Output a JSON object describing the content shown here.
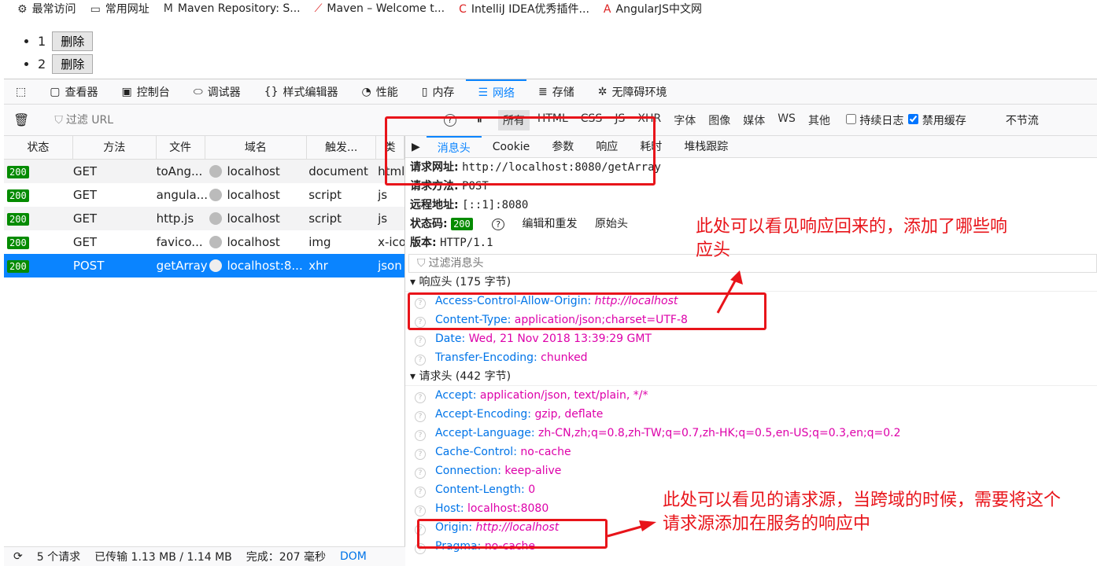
{
  "bookmarks": [
    {
      "icon": "gear-icon",
      "label": "最常访问"
    },
    {
      "icon": "folder-icon",
      "label": "常用网址"
    },
    {
      "icon": "maven-icon",
      "label": "Maven Repository: S..."
    },
    {
      "icon": "feather-icon",
      "label": "Maven – Welcome t..."
    },
    {
      "icon": "intellij-icon",
      "label": "IntelliJ IDEA优秀插件..."
    },
    {
      "icon": "angular-icon",
      "label": "AngularJS中文网"
    }
  ],
  "page": {
    "items": [
      {
        "num": "1",
        "button": "删除"
      },
      {
        "num": "2",
        "button": "删除"
      }
    ]
  },
  "toolbar": {
    "tabs": [
      {
        "icon": "inspector-icon",
        "label": "查看器"
      },
      {
        "icon": "console-icon",
        "label": "控制台"
      },
      {
        "icon": "debugger-icon",
        "label": "调试器"
      },
      {
        "icon": "style-editor-icon",
        "label": "样式编辑器"
      },
      {
        "icon": "performance-icon",
        "label": "性能"
      },
      {
        "icon": "memory-icon",
        "label": "内存"
      },
      {
        "icon": "network-icon",
        "label": "网络",
        "active": true
      },
      {
        "icon": "storage-icon",
        "label": "存储"
      },
      {
        "icon": "accessibility-icon",
        "label": "无障碍环境"
      }
    ]
  },
  "filter": {
    "placeholder": "过滤 URL",
    "types": [
      "所有",
      "HTML",
      "CSS",
      "JS",
      "XHR",
      "字体",
      "图像",
      "媒体",
      "WS",
      "其他"
    ],
    "persist_log": "持续日志",
    "persist_checked": false,
    "disable_cache": "禁用缓存",
    "cache_checked": true,
    "throttle": "不节流"
  },
  "table": {
    "headers": [
      "状态",
      "方法",
      "文件",
      "域名",
      "触发...",
      "类"
    ],
    "rows": [
      {
        "status": "200",
        "method": "GET",
        "file": "toAng...",
        "domain": "localhost",
        "cause": "document",
        "type": "html"
      },
      {
        "status": "200",
        "method": "GET",
        "file": "angula...",
        "domain": "localhost",
        "cause": "script",
        "type": "js"
      },
      {
        "status": "200",
        "method": "GET",
        "file": "http.js",
        "domain": "localhost",
        "cause": "script",
        "type": "js"
      },
      {
        "status": "200",
        "method": "GET",
        "file": "favico...",
        "domain": "localhost",
        "cause": "img",
        "type": "x-icon"
      },
      {
        "status": "200",
        "method": "POST",
        "file": "getArray",
        "domain": "localhost:8...",
        "cause": "xhr",
        "type": "json",
        "selected": true
      }
    ]
  },
  "status_bar": {
    "requests": "5 个请求",
    "transferred": "已传输 1.13 MB / 1.14 MB",
    "finish": "完成：207 毫秒",
    "dom": "DOM"
  },
  "details": {
    "tabs": [
      "消息头",
      "Cookie",
      "参数",
      "响应",
      "耗时",
      "堆栈跟踪"
    ],
    "url_label": "请求网址:",
    "url": "http://localhost:8080/getArray",
    "method_label": "请求方法:",
    "method": "POST",
    "remote_label": "远程地址:",
    "remote": "[::1]:8080",
    "status_label": "状态码:",
    "status": "200",
    "edit_resend": "编辑和重发",
    "raw_headers": "原始头",
    "version_label": "版本:",
    "version": "HTTP/1.1",
    "filter_placeholder": "过滤消息头",
    "response_section": "响应头 (175 字节)",
    "response_headers": [
      {
        "k": "Access-Control-Allow-Origin:",
        "v": "http://localhost",
        "italic": true
      },
      {
        "k": "Content-Type:",
        "v": "application/json;charset=UTF-8"
      },
      {
        "k": "Date:",
        "v": "Wed, 21 Nov 2018 13:39:29 GMT"
      },
      {
        "k": "Transfer-Encoding:",
        "v": "chunked"
      }
    ],
    "request_section": "请求头 (442 字节)",
    "request_headers": [
      {
        "k": "Accept:",
        "v": "application/json, text/plain, */*"
      },
      {
        "k": "Accept-Encoding:",
        "v": "gzip, deflate"
      },
      {
        "k": "Accept-Language:",
        "v": "zh-CN,zh;q=0.8,zh-TW;q=0.7,zh-HK;q=0.5,en-US;q=0.3,en;q=0.2"
      },
      {
        "k": "Cache-Control:",
        "v": "no-cache"
      },
      {
        "k": "Connection:",
        "v": "keep-alive"
      },
      {
        "k": "Content-Length:",
        "v": "0"
      },
      {
        "k": "Host:",
        "v": "localhost:8080"
      },
      {
        "k": "Origin:",
        "v": "http://localhost",
        "italic": true
      },
      {
        "k": "Pragma:",
        "v": "no-cache"
      }
    ]
  },
  "annotations": {
    "note1": "此处可以看见响应回来的，添加了哪些响应头",
    "note2": "此处可以看见的请求源，当跨域的时候，需要将这个请求源添加在服务的响应中",
    "color": "#e8141a"
  }
}
